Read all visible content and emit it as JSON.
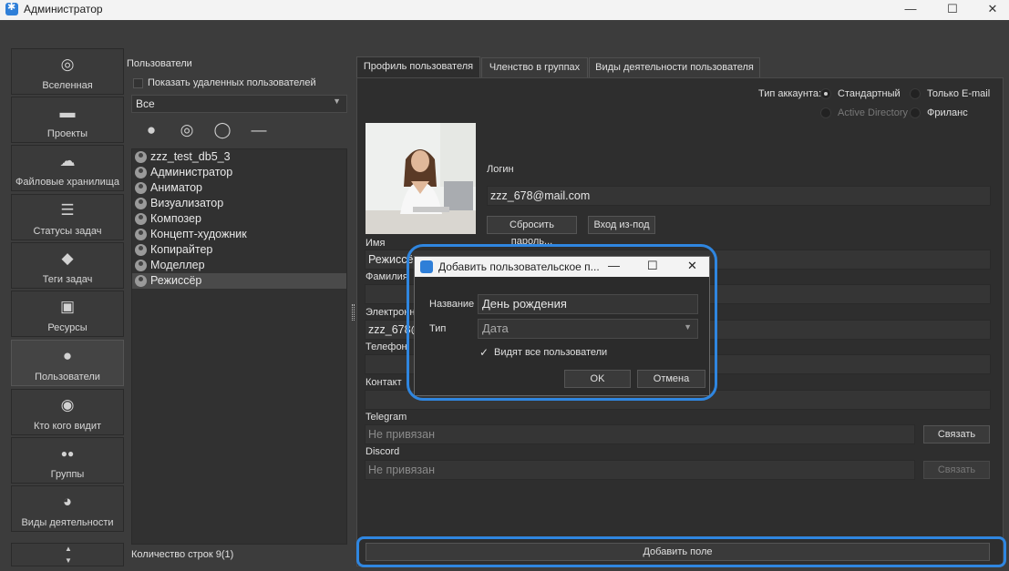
{
  "window": {
    "title": "Администратор",
    "minimize": "—",
    "maximize": "☐",
    "close": "✕"
  },
  "nav": [
    {
      "label": "Вселенная",
      "icon": "universe-icon",
      "glyph": "◎"
    },
    {
      "label": "Проекты",
      "icon": "folder-icon",
      "glyph": "▬"
    },
    {
      "label": "Файловые хранилища",
      "icon": "cloud-icon",
      "glyph": "☁"
    },
    {
      "label": "Статусы задач",
      "icon": "task-status-icon",
      "glyph": "☰"
    },
    {
      "label": "Теги задач",
      "icon": "tag-icon",
      "glyph": "◆"
    },
    {
      "label": "Ресурсы",
      "icon": "inbox-icon",
      "glyph": "▣"
    },
    {
      "label": "Пользователи",
      "icon": "user-icon",
      "glyph": "●"
    },
    {
      "label": "Кто кого видит",
      "icon": "eye-icon",
      "glyph": "◉"
    },
    {
      "label": "Группы",
      "icon": "group-icon",
      "glyph": "●●"
    },
    {
      "label": "Виды деятельности",
      "icon": "palette-icon",
      "glyph": "◕"
    }
  ],
  "nav_scroll": {
    "up": "▲",
    "down": "▼"
  },
  "users": {
    "title": "Пользователи",
    "show_deleted": "Показать удаленных пользователей",
    "filter": "Все",
    "tools": [
      "user-add-icon",
      "user-circle-icon",
      "user-outline-icon",
      "minus-icon"
    ],
    "list": [
      "zzz_test_db5_3",
      "Администратор",
      "Аниматор",
      "Визуализатор",
      "Композер",
      "Концепт-художник",
      "Копирайтер",
      "Моделлер",
      "Режиссёр"
    ],
    "selected_index": 8,
    "row_count": "Количество строк 9(1)"
  },
  "tabs": [
    "Профиль пользователя",
    "Членство в группах",
    "Виды деятельности пользователя"
  ],
  "profile": {
    "account_type_label": "Тип аккаунта:",
    "account_types": [
      "Стандартный",
      "Только E-mail",
      "Active Directory",
      "Фриланс"
    ],
    "login_label": "Логин",
    "login": "zzz_678@mail.com",
    "reset_password": "Сбросить пароль...",
    "login_as": "Вход из-под",
    "first_name_label": "Имя",
    "first_name": "Режиссёр",
    "last_name_label": "Фамилия",
    "email_label": "Электронная",
    "email": "zzz_678@",
    "phone_label": "Телефон",
    "contact_label": "Контакт",
    "telegram_label": "Telegram",
    "telegram": "Не привязан",
    "telegram_link": "Связать",
    "discord_label": "Discord",
    "discord": "Не привязан",
    "discord_link": "Связать",
    "add_field": "Добавить поле"
  },
  "dialog": {
    "title": "Добавить пользовательское п...",
    "name_label": "Название",
    "name_value": "День рождения",
    "type_label": "Тип",
    "type_value": "Дата",
    "visible_all": "Видят все пользователи",
    "ok": "OK",
    "cancel": "Отмена"
  },
  "colors": {
    "highlight": "#2f86e0",
    "accent_icon": "#2f7fd8"
  }
}
